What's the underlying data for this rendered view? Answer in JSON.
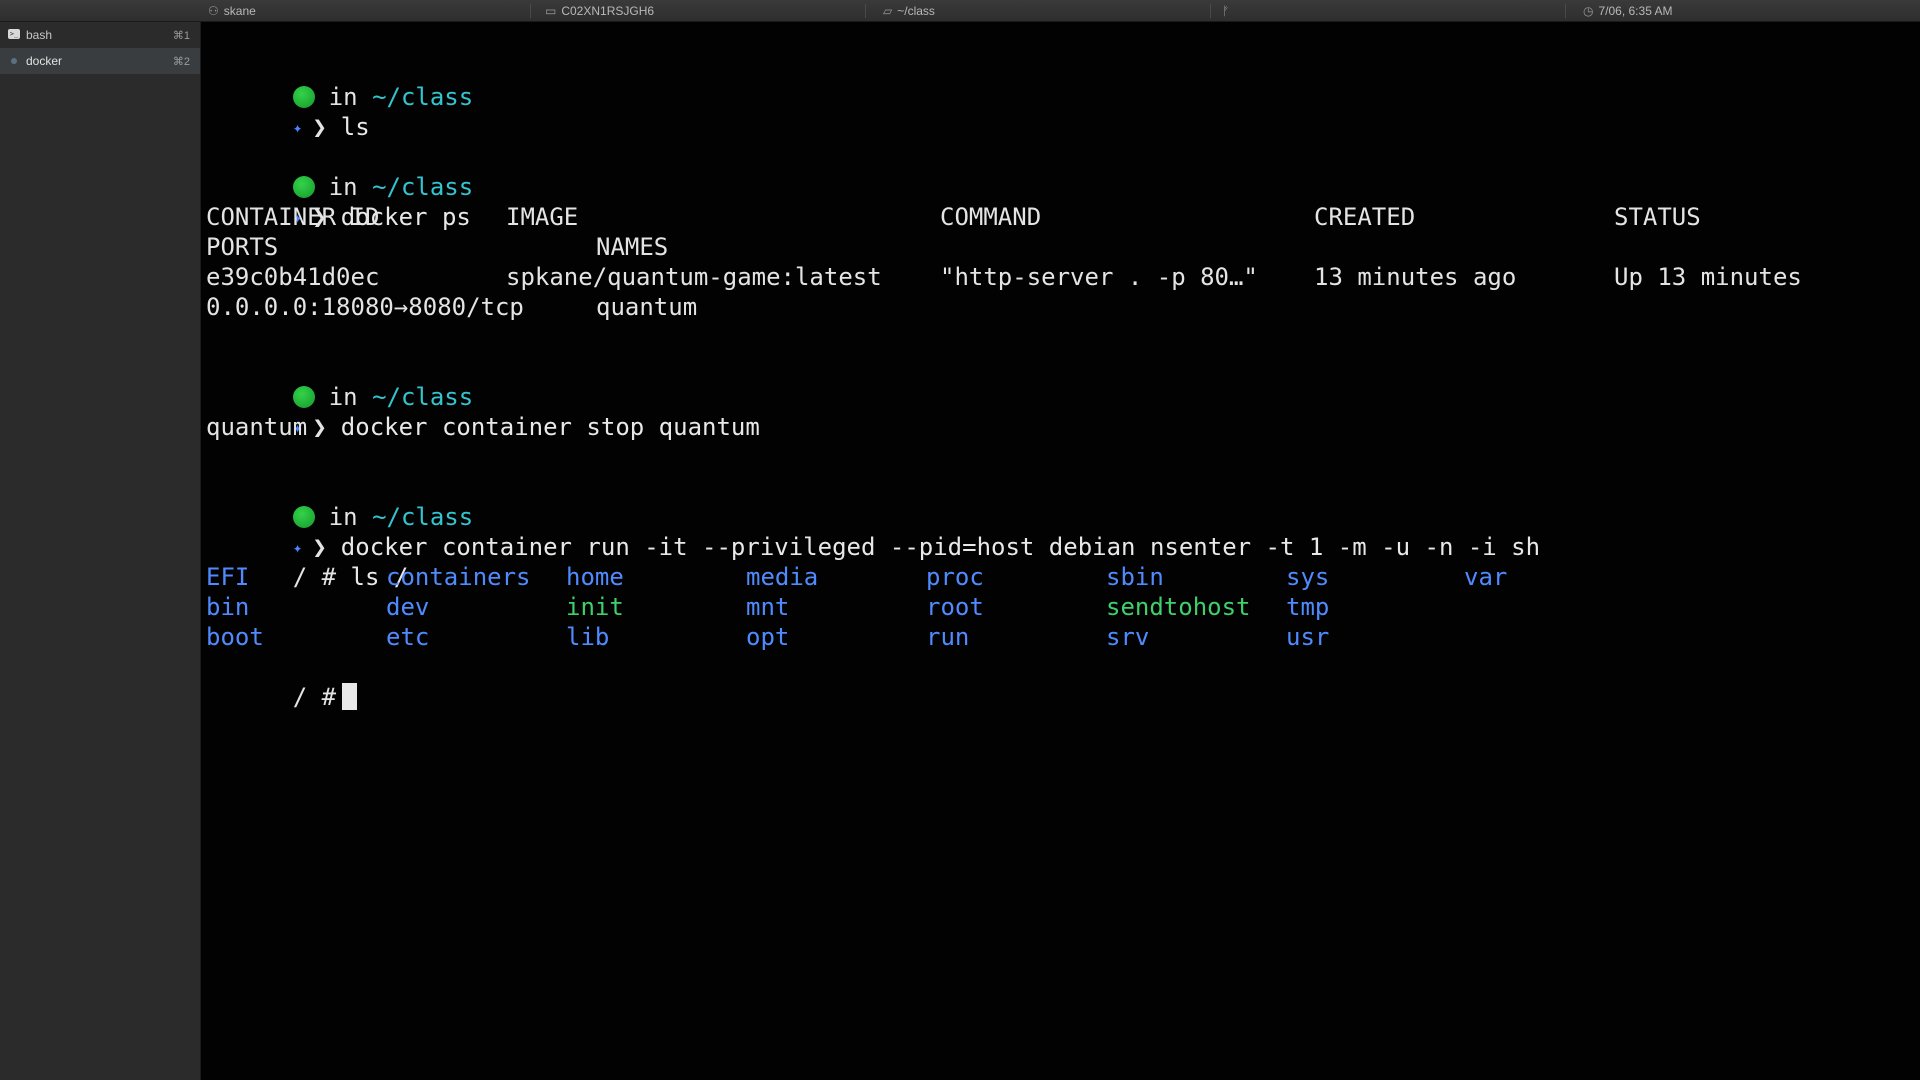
{
  "status_bar": {
    "user": "skane",
    "host": "C02XN1RSJGH6",
    "dir": "~/class",
    "git_mark": "ᚠ",
    "clock": "7/06, 6:35 AM"
  },
  "sidebar": {
    "tabs": [
      {
        "label": "bash",
        "shortcut": "⌘1",
        "active": false
      },
      {
        "label": "docker",
        "shortcut": "⌘2",
        "active": true
      }
    ]
  },
  "terminal": {
    "blocks": [
      {
        "prompt_in": "in",
        "prompt_path": "~/class",
        "command": "ls"
      },
      {
        "prompt_in": "in",
        "prompt_path": "~/class",
        "command": "docker ps",
        "output": {
          "header1": [
            "CONTAINER ID",
            "IMAGE",
            "COMMAND",
            "CREATED",
            "STATUS"
          ],
          "header2": [
            "PORTS",
            "NAMES"
          ],
          "row1": [
            "e39c0b41d0ec",
            "spkane/quantum-game:latest",
            "\"http-server . -p 80…\"",
            "13 minutes ago",
            "Up 13 minutes"
          ],
          "row2": [
            "0.0.0.0:18080→8080/tcp",
            "quantum"
          ]
        }
      },
      {
        "prompt_in": "in",
        "prompt_path": "~/class",
        "command": "docker container stop quantum",
        "output_text": "quantum"
      },
      {
        "prompt_in": "in",
        "prompt_path": "~/class",
        "command": "docker container run -it --privileged --pid=host debian nsenter -t 1 -m -u -n -i sh"
      }
    ],
    "root_session": {
      "prompt": "/ #",
      "command": "ls /",
      "listing": [
        [
          {
            "name": "EFI",
            "kind": "dir"
          },
          {
            "name": "containers",
            "kind": "dir"
          },
          {
            "name": "home",
            "kind": "dir"
          },
          {
            "name": "media",
            "kind": "dir"
          },
          {
            "name": "proc",
            "kind": "dir"
          },
          {
            "name": "sbin",
            "kind": "dir"
          },
          {
            "name": "sys",
            "kind": "dir"
          },
          {
            "name": "var",
            "kind": "dir"
          }
        ],
        [
          {
            "name": "bin",
            "kind": "dir"
          },
          {
            "name": "dev",
            "kind": "dir"
          },
          {
            "name": "init",
            "kind": "exe"
          },
          {
            "name": "mnt",
            "kind": "dir"
          },
          {
            "name": "root",
            "kind": "dir"
          },
          {
            "name": "sendtohost",
            "kind": "exe"
          },
          {
            "name": "tmp",
            "kind": "dir"
          }
        ],
        [
          {
            "name": "boot",
            "kind": "dir"
          },
          {
            "name": "etc",
            "kind": "dir"
          },
          {
            "name": "lib",
            "kind": "dir"
          },
          {
            "name": "opt",
            "kind": "dir"
          },
          {
            "name": "run",
            "kind": "dir"
          },
          {
            "name": "srv",
            "kind": "dir"
          },
          {
            "name": "usr",
            "kind": "dir"
          }
        ]
      ],
      "final_prompt": "/ #"
    }
  },
  "colors": {
    "path": "#34c4cf",
    "dir": "#4f8bff",
    "exe": "#3fd06a",
    "ok_dot": "#22b838",
    "prompt_star": "#4a86ff"
  },
  "icons": {
    "user": "user-icon",
    "host": "laptop-icon",
    "dir": "folder-icon",
    "git": "git-branch-icon",
    "clock": "clock-icon",
    "tab_terminal": "terminal-icon"
  }
}
